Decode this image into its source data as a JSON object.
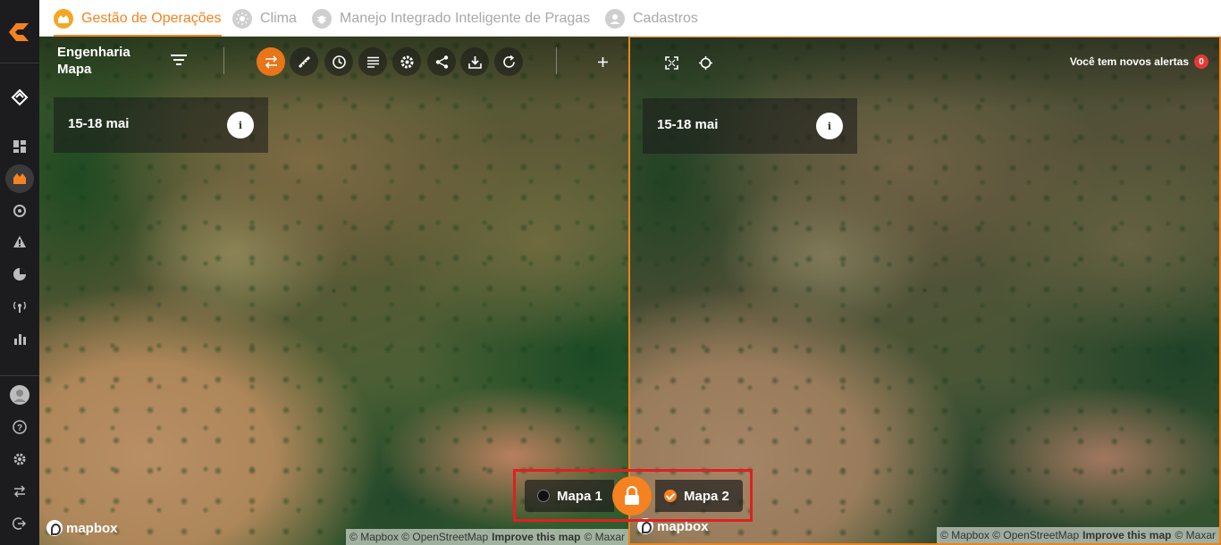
{
  "tabs": [
    {
      "label": "Gestão de Operações",
      "icon": "operations-icon",
      "active": true
    },
    {
      "label": "Clima",
      "icon": "sun-icon",
      "active": false
    },
    {
      "label": "Manejo Integrado Inteligente de Pragas",
      "icon": "bug-icon",
      "active": false
    },
    {
      "label": "Cadastros",
      "icon": "user-icon",
      "active": false
    }
  ],
  "sidebar": {
    "icons": [
      "logo-icon",
      "brand-mark-icon",
      "dashboard-icon",
      "operations-icon",
      "gauge-icon",
      "alert-icon",
      "pie-chart-icon",
      "antenna-icon",
      "bar-chart-icon",
      "avatar",
      "help-icon",
      "settings-icon",
      "swap-icon",
      "logout-icon"
    ],
    "active": "operations-icon"
  },
  "header": {
    "line1": "Engenharia",
    "line2": "Mapa",
    "alerts_label": "Você tem novos alertas",
    "alerts_count": "0"
  },
  "toolbar": [
    "compare-icon",
    "ruler-icon",
    "clock-icon",
    "list-icon",
    "gear-icon",
    "share-icon",
    "download-icon",
    "refresh-icon"
  ],
  "zoom": [
    "zoom-in-icon",
    "zoom-out-icon",
    "fullscreen-icon",
    "locate-icon"
  ],
  "map_left": {
    "date": "15-18 mai",
    "info": "i"
  },
  "map_right": {
    "date": "15-18 mai",
    "info": "i"
  },
  "mapbox_logo": "mapbox",
  "attribution": {
    "mapbox": "© Mapbox",
    "osm": "© OpenStreetMap",
    "improve": "Improve this map",
    "maxar": "© Maxar"
  },
  "compare": {
    "map1": "Mapa 1",
    "map2": "Mapa 2",
    "selected": "Mapa 2"
  },
  "colors": {
    "accent": "#f58220",
    "alert": "#e53935",
    "highlight_box": "#e02020"
  }
}
